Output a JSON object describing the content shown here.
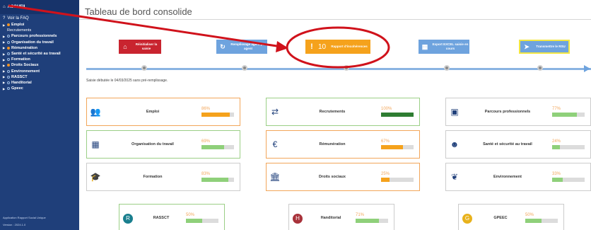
{
  "sidebar": {
    "top_label": "ACCUEIL",
    "faq_label": "Voir la FAQ",
    "items": [
      {
        "label": "Emploi",
        "style": "orange"
      },
      {
        "label": "Recrutements",
        "style": "sub"
      },
      {
        "label": "Parcours professionnels",
        "style": "plain"
      },
      {
        "label": "Organisation du travail",
        "style": "plain"
      },
      {
        "label": "Rémunération",
        "style": "orange"
      },
      {
        "label": "Santé et sécurité au travail",
        "style": "plain"
      },
      {
        "label": "Formation",
        "style": "plain"
      },
      {
        "label": "Droits Sociaux",
        "style": "orange"
      },
      {
        "label": "Environnement",
        "style": "plain"
      },
      {
        "label": "RASSCT",
        "style": "plain"
      },
      {
        "label": "Handitorial",
        "style": "plain"
      },
      {
        "label": "Gpeec",
        "style": "plain"
      }
    ],
    "footer_app": "Application Rapport Social Unique",
    "footer_version": "Version : 2024.1.0"
  },
  "header": {
    "title": "Tableau de bord consolide"
  },
  "actions": {
    "reset": {
      "label": "Réinitialiser la saisie",
      "icon": "home-icon"
    },
    "agent": {
      "label": "Remplissage agent par agent",
      "icon": "refresh-icon"
    },
    "report": {
      "count": "10",
      "label": "Rapport d'incohérences",
      "icon": "alert-icon"
    },
    "export": {
      "label": "Export EXCEL saisie en cours",
      "icon": "table-icon"
    },
    "send": {
      "label": "Transmettre le RSU",
      "icon": "send-icon"
    }
  },
  "status_text": "Saisie débutée le 04/03/2025 sans pré-remplissage.",
  "cards": [
    {
      "name": "Emploi",
      "percent": "86%",
      "value": 86,
      "icon": "people-icon",
      "border": "orange",
      "fill_color": "#f5a21c"
    },
    {
      "name": "Recrutements",
      "percent": "100%",
      "value": 100,
      "icon": "exchange-arrows-icon",
      "border": "green",
      "fill_color": "#2e7d32"
    },
    {
      "name": "Parcours professionnels",
      "percent": "77%",
      "value": 77,
      "icon": "career-icon",
      "border": "plain",
      "fill_color": "#8fd07a"
    },
    {
      "name": "Organisation du travail",
      "percent": "69%",
      "value": 69,
      "icon": "calendar-icon",
      "border": "green",
      "fill_color": "#8fd07a"
    },
    {
      "name": "Rémunération",
      "percent": "67%",
      "value": 67,
      "icon": "euro-icon",
      "border": "orange",
      "fill_color": "#f5a21c"
    },
    {
      "name": "Santé et sécurité au travail",
      "percent": "24%",
      "value": 24,
      "icon": "smiley-icon",
      "border": "plain",
      "fill_color": "#8fd07a"
    },
    {
      "name": "Formation",
      "percent": "83%",
      "value": 83,
      "icon": "graduation-cap-icon",
      "border": "plain",
      "fill_color": "#8fd07a"
    },
    {
      "name": "Droits sociaux",
      "percent": "25%",
      "value": 25,
      "icon": "institution-icon",
      "border": "orange",
      "fill_color": "#f5a21c"
    },
    {
      "name": "Environnement",
      "percent": "33%",
      "value": 33,
      "icon": "leaf-icon",
      "border": "plain",
      "fill_color": "#8fd07a"
    },
    {
      "name": "RASSCT",
      "percent": "50%",
      "value": 50,
      "icon": "rassct-icon",
      "border": "green",
      "fill_color": "#8fd07a"
    },
    {
      "name": "Handitorial",
      "percent": "71%",
      "value": 71,
      "icon": "handitorial-icon",
      "border": "plain",
      "fill_color": "#8fd07a"
    },
    {
      "name": "GPEEC",
      "percent": "50%",
      "value": 50,
      "icon": "gpeec-icon",
      "border": "plain",
      "fill_color": "#8fd07a"
    }
  ]
}
